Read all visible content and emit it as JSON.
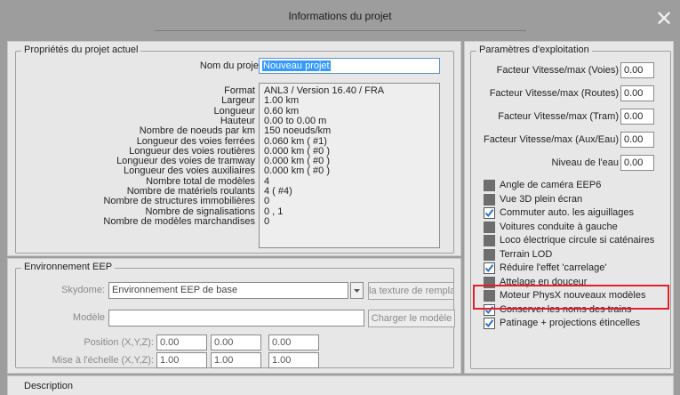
{
  "window": {
    "title": "Informations du projet",
    "close_icon": "close-icon"
  },
  "project": {
    "group_title": "Propriétés du projet actuel",
    "name_label": "Nom du projet",
    "name_value": "Nouveau projet",
    "info": [
      {
        "label": "Format",
        "value": "ANL3 / Version 16.40 / FRA"
      },
      {
        "label": "Largeur",
        "value": "1.00 km"
      },
      {
        "label": "Longueur",
        "value": "0.60 km"
      },
      {
        "label": "Hauteur",
        "value": "0.00 to 0.00 m"
      },
      {
        "label": "Nombre de noeuds par km",
        "value": "150  noeuds/km"
      },
      {
        "label": "Longueur des voies ferrées",
        "value": "0.060 km  ( #1)"
      },
      {
        "label": "Longueur des voies routières",
        "value": "0.000 km  ( #0 )"
      },
      {
        "label": "Longueur des voies de tramway",
        "value": "0.000 km  ( #0 )"
      },
      {
        "label": "Longueur des voies auxiliaires",
        "value": "0.000 km  ( #0 )"
      },
      {
        "label": "Nombre total de modèles",
        "value": "4"
      },
      {
        "label": "Nombre de matériels roulants",
        "value": "4 ( #4)"
      },
      {
        "label": "Nombre de structures immobilières",
        "value": "0"
      },
      {
        "label": "Nombre de signalisations",
        "value": "0 , 1"
      },
      {
        "label": "Nombre de modèles marchandises",
        "value": "0"
      }
    ]
  },
  "environment": {
    "group_title": "Environnement EEP",
    "skydome_label": "Skydome:",
    "skydome_value": "Environnement EEP de base",
    "texture_button": "la texture de rempla",
    "model_label": "Modèle",
    "model_value": "",
    "load_model_button": "Charger le modèle",
    "position_label": "Position (X,Y,Z):",
    "position_values": [
      "0.00",
      "0.00",
      "0.00"
    ],
    "scale_label": "Mise à l'échelle (X,Y,Z):",
    "scale_values": [
      "1.00",
      "1.00",
      "1.00"
    ]
  },
  "operation": {
    "group_title": "Paramètres d'exploitation",
    "factors": [
      {
        "label": "Facteur Vitesse/max (Voies)",
        "value": "0.00"
      },
      {
        "label": "Facteur Vitesse/max (Routes)",
        "value": "0.00"
      },
      {
        "label": "Facteur Vitesse/max (Tram)",
        "value": "0.00"
      },
      {
        "label": "Facteur Vitesse/max (Aux/Eau)",
        "value": "0.00"
      },
      {
        "label": "Niveau de l'eau",
        "value": "0.00"
      }
    ],
    "options": [
      {
        "label": "Angle de caméra EEP6",
        "checked": false
      },
      {
        "label": "Vue 3D plein écran",
        "checked": false
      },
      {
        "label": "Commuter auto. les aiguillages",
        "checked": true
      },
      {
        "label": "Voitures conduite à gauche",
        "checked": false
      },
      {
        "label": "Loco électrique circule si caténaires",
        "checked": false
      },
      {
        "label": "Terrain LOD",
        "checked": false
      },
      {
        "label": "Réduire l'effet 'carrelage'",
        "checked": true
      },
      {
        "label": "Attelage en douceur",
        "checked": false
      },
      {
        "label": "Moteur PhysX nouveaux modèles",
        "checked": false
      },
      {
        "label": "Conserver les noms des trains",
        "checked": true
      },
      {
        "label": "Patinage + projections étincelles",
        "checked": true
      }
    ],
    "highlight_color": "#e0202a"
  },
  "description": {
    "label": "Description"
  }
}
